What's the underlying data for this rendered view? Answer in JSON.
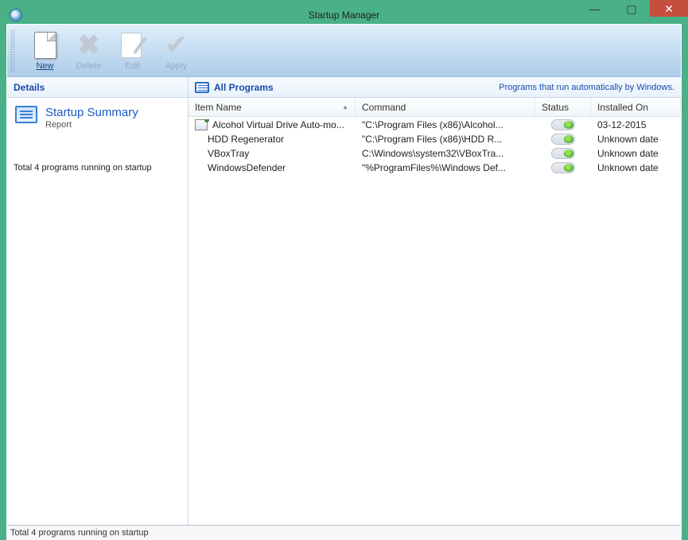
{
  "window": {
    "title": "Startup Manager"
  },
  "toolbar": {
    "new_label": "New",
    "delete_label": "Delete",
    "edit_label": "Edit",
    "apply_label": "Apply"
  },
  "sidebar": {
    "header": "Details",
    "summary_title": "Startup Summary",
    "summary_sub": "Report",
    "status_text": "Total 4 programs running on startup"
  },
  "main": {
    "header_title": "All Programs",
    "header_hint": "Programs that run automatically by Windows.",
    "columns": {
      "name": "Item Name",
      "command": "Command",
      "status": "Status",
      "installed": "Installed On"
    },
    "rows": [
      {
        "name": "Alcohol Virtual Drive Auto-mo...",
        "command": "\"C:\\Program Files (x86)\\Alcohol...",
        "installed": "03-12-2015",
        "has_icon": true
      },
      {
        "name": "HDD Regenerator",
        "command": "\"C:\\Program Files (x86)\\HDD R...",
        "installed": "Unknown date",
        "has_icon": false
      },
      {
        "name": "VBoxTray",
        "command": "C:\\Windows\\system32\\VBoxTra...",
        "installed": "Unknown date",
        "has_icon": false
      },
      {
        "name": "WindowsDefender",
        "command": "\"%ProgramFiles%\\Windows Def...",
        "installed": "Unknown date",
        "has_icon": false
      }
    ]
  },
  "statusbar": {
    "text": "Total 4 programs running on startup"
  }
}
